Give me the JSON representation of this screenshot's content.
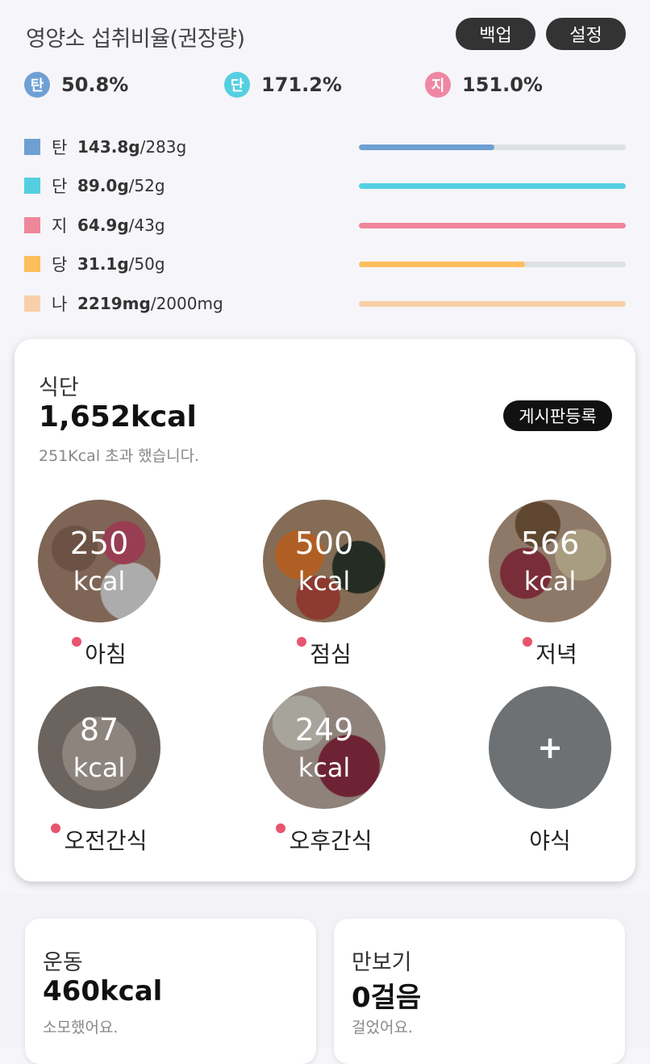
{
  "header": {
    "title": "영양소 섭취비율(권장량)",
    "backup_label": "백업",
    "settings_label": "설정"
  },
  "ratios": [
    {
      "badge": "탄",
      "value": "50.8%",
      "color": "#6fa0d3"
    },
    {
      "badge": "단",
      "value": "171.2%",
      "color": "#55cfe0"
    },
    {
      "badge": "지",
      "value": "151.0%",
      "color": "#ef87a3"
    }
  ],
  "nutrients": [
    {
      "name": "탄",
      "consumed": "143.8g",
      "target": "/283g",
      "color": "#6fa0d3",
      "progress": 0.508
    },
    {
      "name": "단",
      "consumed": "89.0g",
      "target": "/52g",
      "color": "#55cfe0",
      "progress": 1.0
    },
    {
      "name": "지",
      "consumed": "64.9g",
      "target": "/43g",
      "color": "#ef8699",
      "progress": 1.0
    },
    {
      "name": "당",
      "consumed": "31.1g",
      "target": "/50g",
      "color": "#ffbe5c",
      "progress": 0.622
    },
    {
      "name": "나",
      "consumed": "2219mg",
      "target": "/2000mg",
      "color": "#f8cfa8",
      "progress": 1.0
    }
  ],
  "diet": {
    "label": "식단",
    "total": "1,652kcal",
    "note": "251Kcal 초과 했습니다.",
    "post_label": "게시판등록"
  },
  "meals": [
    {
      "kcal": "250",
      "unit": "kcal",
      "name": "아침",
      "logged": true
    },
    {
      "kcal": "500",
      "unit": "kcal",
      "name": "점심",
      "logged": true
    },
    {
      "kcal": "566",
      "unit": "kcal",
      "name": "저녁",
      "logged": true
    },
    {
      "kcal": "87",
      "unit": "kcal",
      "name": "오전간식",
      "logged": true
    },
    {
      "kcal": "249",
      "unit": "kcal",
      "name": "오후간식",
      "logged": true
    },
    {
      "plus": "+",
      "name": "야식",
      "logged": false
    }
  ],
  "exercise": {
    "label": "운동",
    "value": "460kcal",
    "note": "소모했어요."
  },
  "pedometer": {
    "label": "만보기",
    "value": "0걸음",
    "note": "걸었어요."
  }
}
